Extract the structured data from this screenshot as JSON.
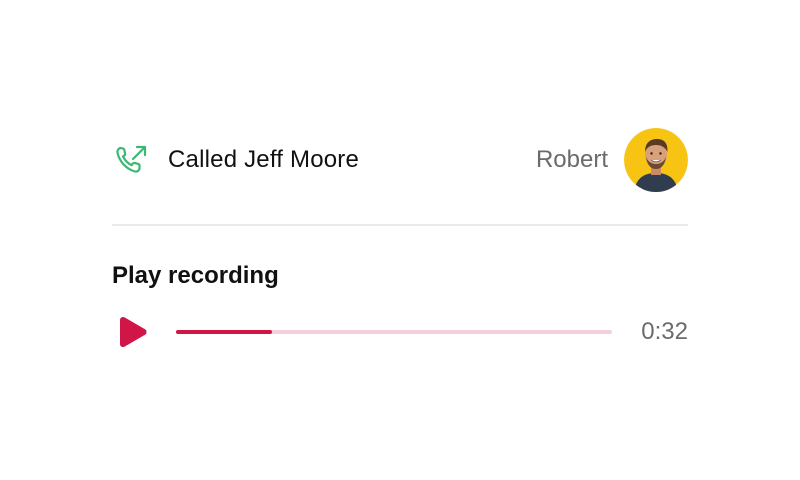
{
  "call": {
    "icon": "phone-outgoing-icon",
    "title": "Called Jeff Moore",
    "agent_name": "Robert",
    "avatar_icon": "avatar"
  },
  "recording": {
    "heading": "Play recording",
    "play_icon": "play-icon",
    "progress": 0.22,
    "duration": "0:32"
  },
  "colors": {
    "call_icon": "#3bb873",
    "accent": "#cf1647",
    "track": "#f5cfdc",
    "avatar_bg": "#f7c414",
    "muted_text": "#6b6b6b"
  }
}
